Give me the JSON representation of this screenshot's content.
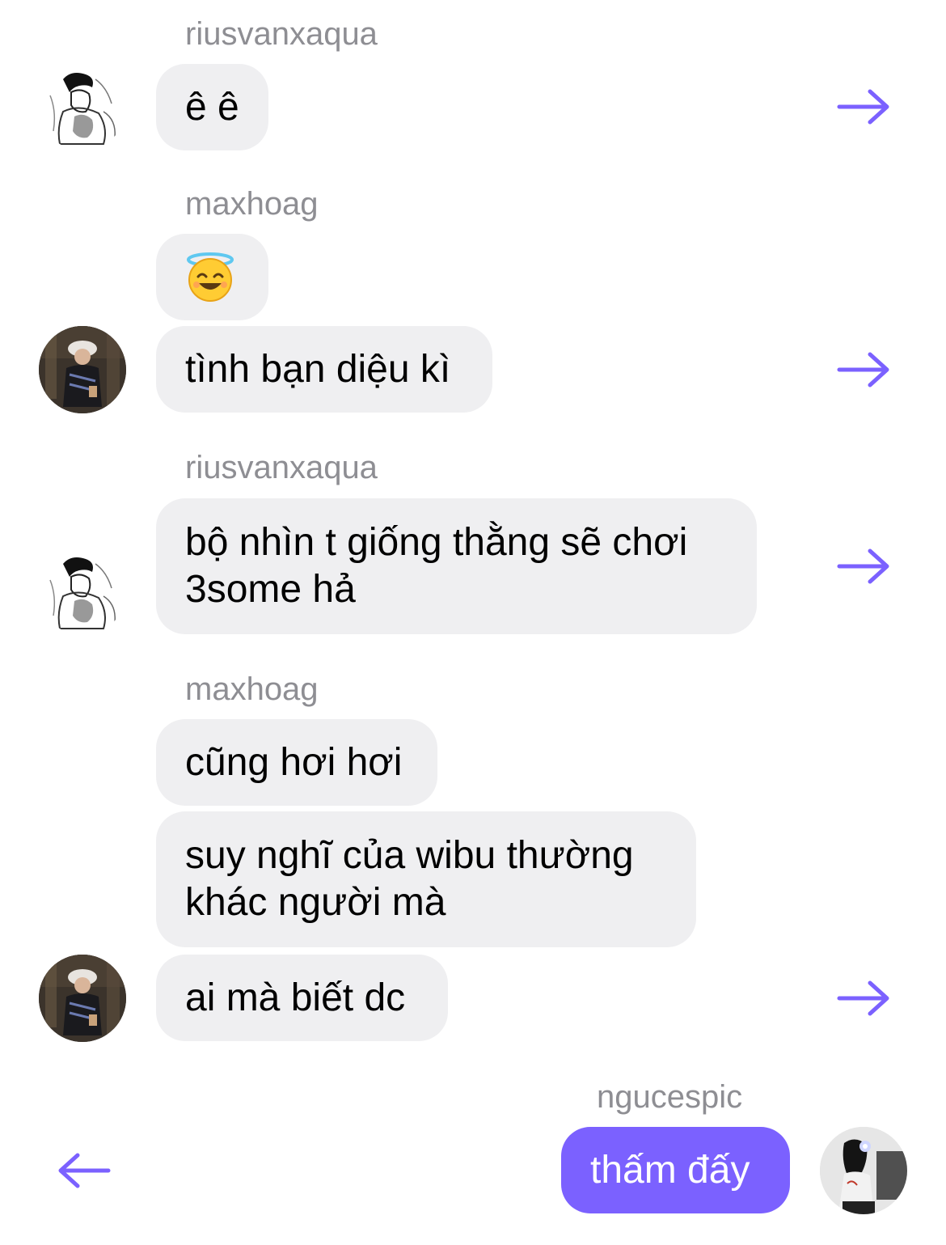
{
  "accent_color": "#7b61ff",
  "bubble_color": "#efeff1",
  "messages": [
    {
      "sender": "riusvanxaqua",
      "text": "ê ê"
    },
    {
      "sender": "maxhoag",
      "emoji": "😇",
      "emoji_name": "smiling-face-with-halo"
    },
    {
      "text": "tình bạn diệu kì"
    },
    {
      "sender": "riusvanxaqua",
      "line1": "bộ nhìn t giống thằng sẽ chơi",
      "line2": "3some hả"
    },
    {
      "sender": "maxhoag",
      "text": "cũng hơi hơi"
    },
    {
      "line1": "suy nghĩ của wibu thường",
      "line2": "khác người mà"
    },
    {
      "text": "ai mà biết dc"
    },
    {
      "sender": "ngucespic",
      "text": "thấm đấy"
    }
  ],
  "icons": {
    "share_forward": "arrow-right-icon",
    "share_back": "arrow-left-icon"
  }
}
